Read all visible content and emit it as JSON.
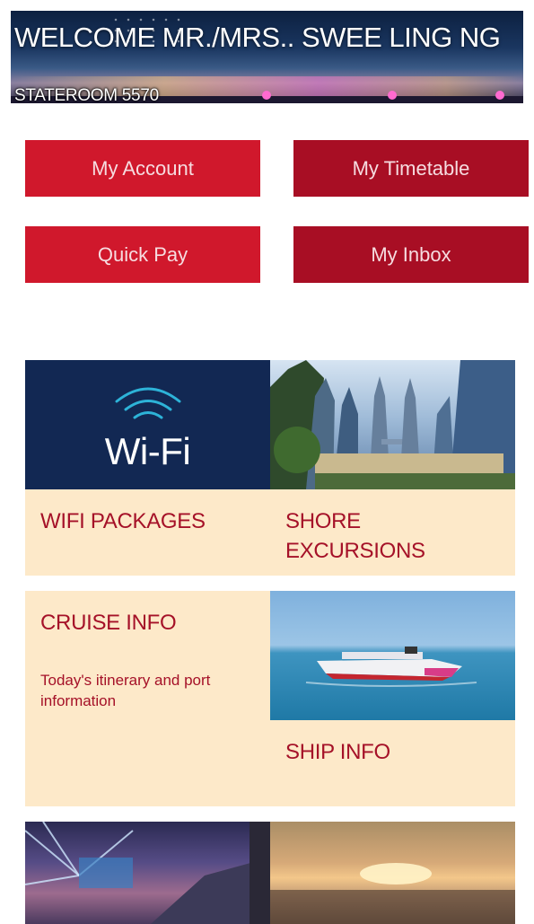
{
  "banner": {
    "welcome": "WELCOME MR./MRS.. SWEE LING NG",
    "stateroom": "STATEROOM 5570"
  },
  "buttons": {
    "my_account": "My Account",
    "my_timetable": "My Timetable",
    "quick_pay": "Quick Pay",
    "my_inbox": "My Inbox"
  },
  "tiles": {
    "wifi": {
      "image_text": "Wi-Fi",
      "label": "WIFI PACKAGES"
    },
    "shore": {
      "label_line1": "SHORE",
      "label_line2": "EXCURSIONS"
    },
    "cruise": {
      "label": "CRUISE INFO",
      "description": "Today's itinerary and port information"
    },
    "ship": {
      "label": "SHIP INFO"
    }
  },
  "colors": {
    "button_light": "#d0182c",
    "button_dark": "#a80e24",
    "tile_cream": "#fde9c9",
    "tile_text": "#a51128",
    "wifi_navy": "#122853"
  }
}
